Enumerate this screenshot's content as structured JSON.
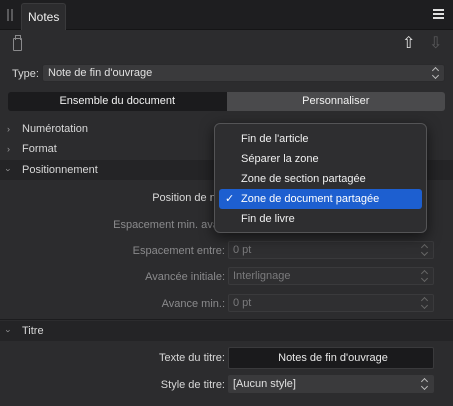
{
  "panel": {
    "tab_label": "Notes"
  },
  "type_row": {
    "label": "Type:",
    "value": "Note de fin d'ouvrage"
  },
  "segmented": {
    "option_a": "Ensemble du document",
    "option_b": "Personnaliser",
    "selected": "option_a"
  },
  "sections": {
    "numerotation": "Numérotation",
    "format": "Format",
    "positionnement": "Positionnement",
    "titre": "Titre"
  },
  "positionnement_fields": {
    "position_label": "Position de not",
    "espacement_min_label": "Espacement min. avan",
    "espacement_entre_label": "Espacement entre:",
    "espacement_entre_value": "0 pt",
    "avancee_initiale_label": "Avancée initiale:",
    "avancee_initiale_value": "Interlignage",
    "avance_min_label": "Avance min.:",
    "avance_min_value": "0 pt"
  },
  "titre_fields": {
    "texte_label": "Texte du titre:",
    "texte_value": "Notes de fin d'ouvrage",
    "style_label": "Style de titre:",
    "style_value": "[Aucun style]"
  },
  "popup": {
    "items": [
      "Fin de l'article",
      "Séparer la zone",
      "Zone de section partagée",
      "Zone de document partagée",
      "Fin de livre"
    ],
    "selected_index": 3,
    "check_glyph": "✓"
  },
  "icons": {
    "arrow_up": "⇧",
    "arrow_down": "⇩",
    "chevron": "›"
  },
  "colors": {
    "accent": "#1d5fd0",
    "panel_bg": "#2c2c2e"
  }
}
